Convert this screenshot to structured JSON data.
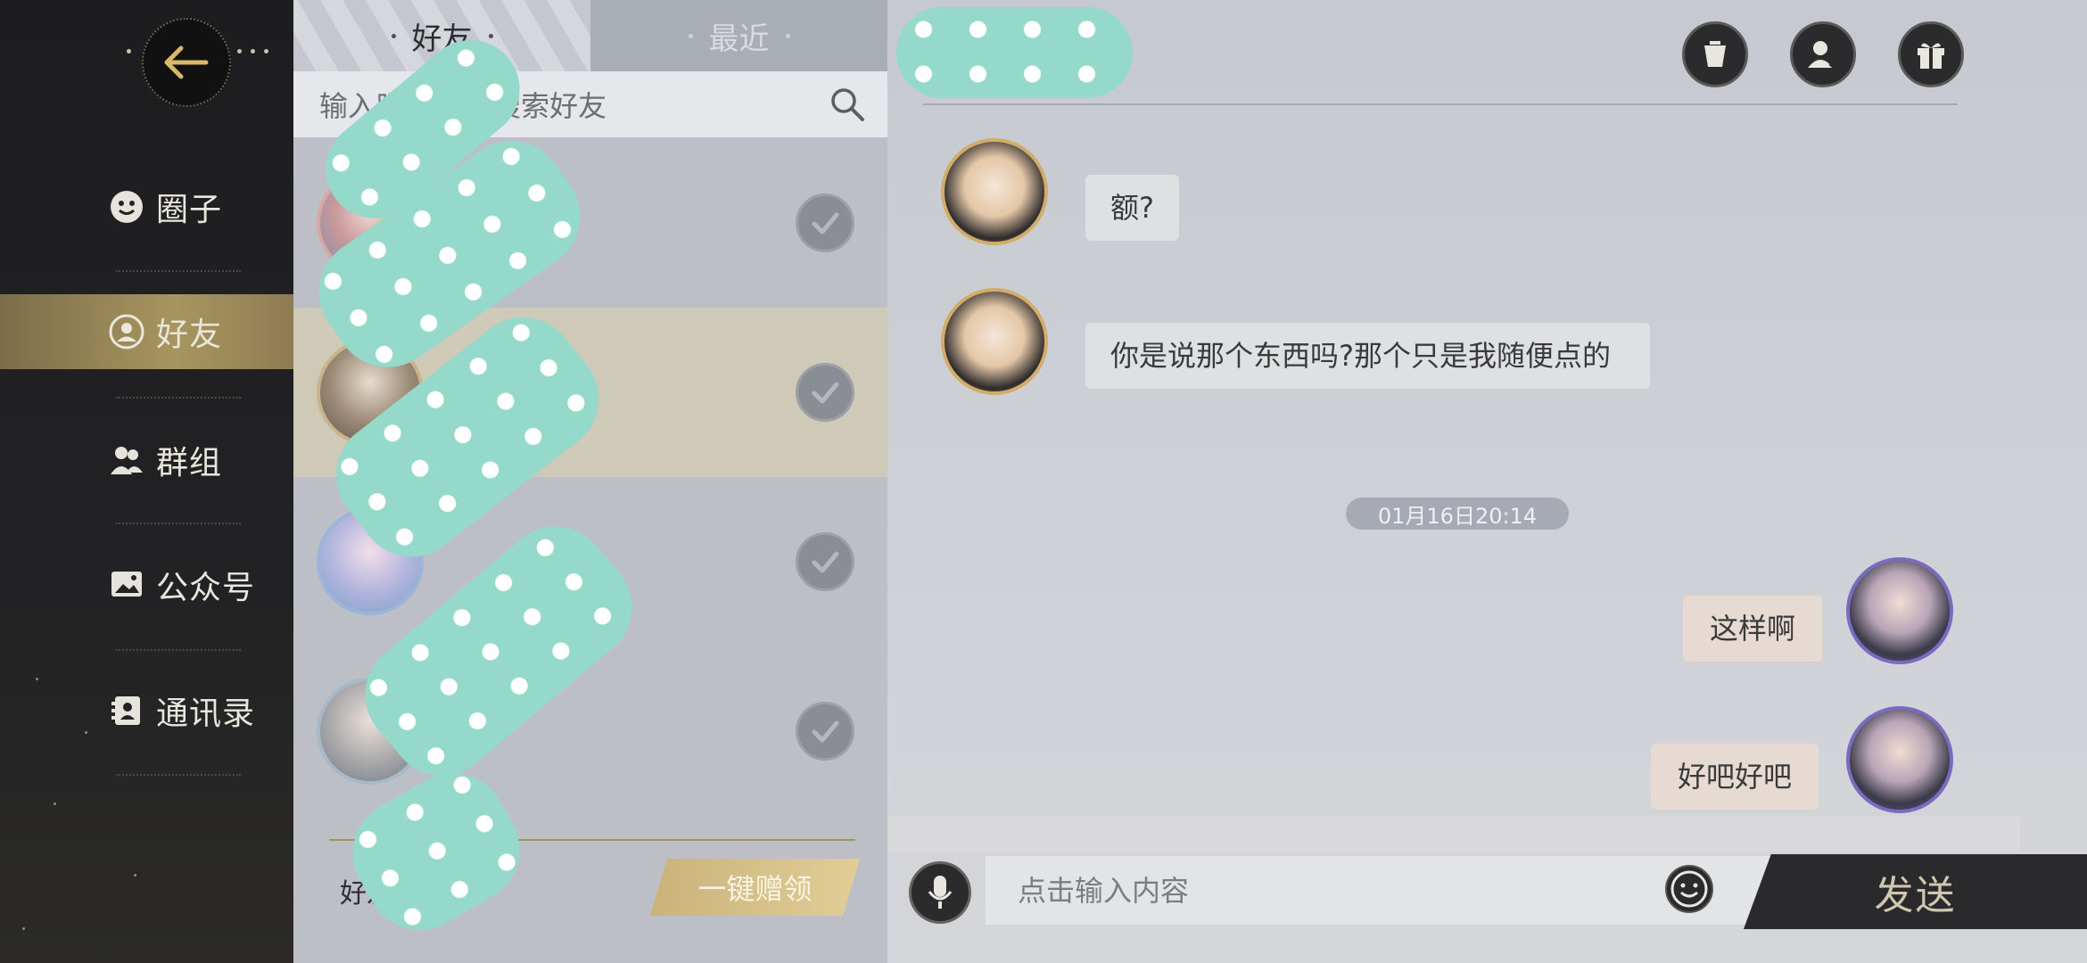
{
  "nav": {
    "items": [
      {
        "label": "圈子",
        "icon": "smiley-icon"
      },
      {
        "label": "好友",
        "icon": "friend-icon",
        "active": true
      },
      {
        "label": "群组",
        "icon": "group-icon"
      },
      {
        "label": "公众号",
        "icon": "image-icon"
      },
      {
        "label": "通讯录",
        "icon": "contacts-icon"
      }
    ]
  },
  "tabs": {
    "friends": "好友",
    "recent": "最近"
  },
  "search": {
    "placeholder": "输入昵称或ID搜索好友"
  },
  "friend_list": {
    "footer_label": "好友",
    "claim_all": "一键赠领"
  },
  "chat": {
    "messages": [
      {
        "side": "in",
        "text": "额?"
      },
      {
        "side": "in",
        "text": "你是说那个东西吗?那个只是我随便点的"
      },
      {
        "side": "out",
        "text": "这样啊"
      },
      {
        "side": "out",
        "text": "好吧好吧"
      }
    ],
    "timestamp": "01月16日20:14",
    "input_placeholder": "点击输入内容",
    "send_label": "发送"
  },
  "colors": {
    "accent_gold": "#a8955f",
    "nav_bg": "#1d1d1f",
    "censor_teal": "#94d9ca"
  }
}
